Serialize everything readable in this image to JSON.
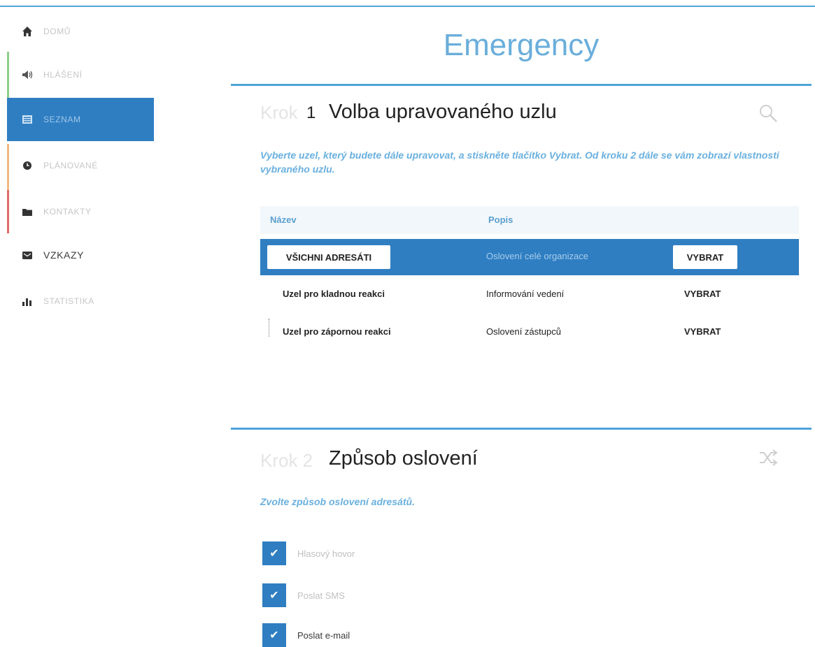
{
  "sidebar": {
    "items": [
      {
        "label": "DOMŮ",
        "icon": "home-icon"
      },
      {
        "label": "HLÁŠENÍ",
        "icon": "megaphone-icon"
      },
      {
        "label": "SEZNAM",
        "icon": "list-icon"
      },
      {
        "label": "PLÁNOVANÉ",
        "icon": "clock-icon"
      },
      {
        "label": "KONTAKTY",
        "icon": "folder-icon"
      },
      {
        "label": "VZKAZY",
        "icon": "message-icon"
      },
      {
        "label": "STATISTIKA",
        "icon": "bar-chart-icon"
      }
    ]
  },
  "page": {
    "title": "Emergency"
  },
  "section1": {
    "prefix": "Krok",
    "number": "1",
    "title": "Volba upravovaného uzlu",
    "description": "Vyberte uzel, který budete dále upravovat, a stiskněte tlačítko Vybrat. Od kroku 2 dále se vám zobrazí vlastnosti vybraného uzlu.",
    "icon": "search-icon",
    "columns": [
      "Název",
      "Popis"
    ],
    "rows": [
      {
        "name": "VŠICHNI ADRESÁTI",
        "desc": "Oslovení celé organizace",
        "action": "VYBRAT",
        "selected": true
      },
      {
        "name": "Uzel pro kladnou reakci",
        "desc": "Informování vedení",
        "action": "VYBRAT",
        "selected": false
      },
      {
        "name": "Uzel pro zápornou reakci",
        "desc": "Oslovení zástupců",
        "action": "VYBRAT",
        "selected": false
      }
    ]
  },
  "section2": {
    "prefix": "Krok 2",
    "title": "Způsob oslovení",
    "description": "Zvolte způsob oslovení adresátů.",
    "icon": "shuffle-icon",
    "options": [
      {
        "label": "Hlasový hovor",
        "checked": true
      },
      {
        "label": "Poslat SMS",
        "checked": true
      },
      {
        "label": "Poslat e-mail",
        "checked": true
      }
    ]
  },
  "colors": {
    "accent": "#2f7ec2",
    "title": "#6aaedb",
    "separator": "#4fa3d8",
    "nav_accent_green": "#8ed08a",
    "nav_accent_orange": "#f0b982",
    "nav_accent_red": "#de6b6b"
  }
}
